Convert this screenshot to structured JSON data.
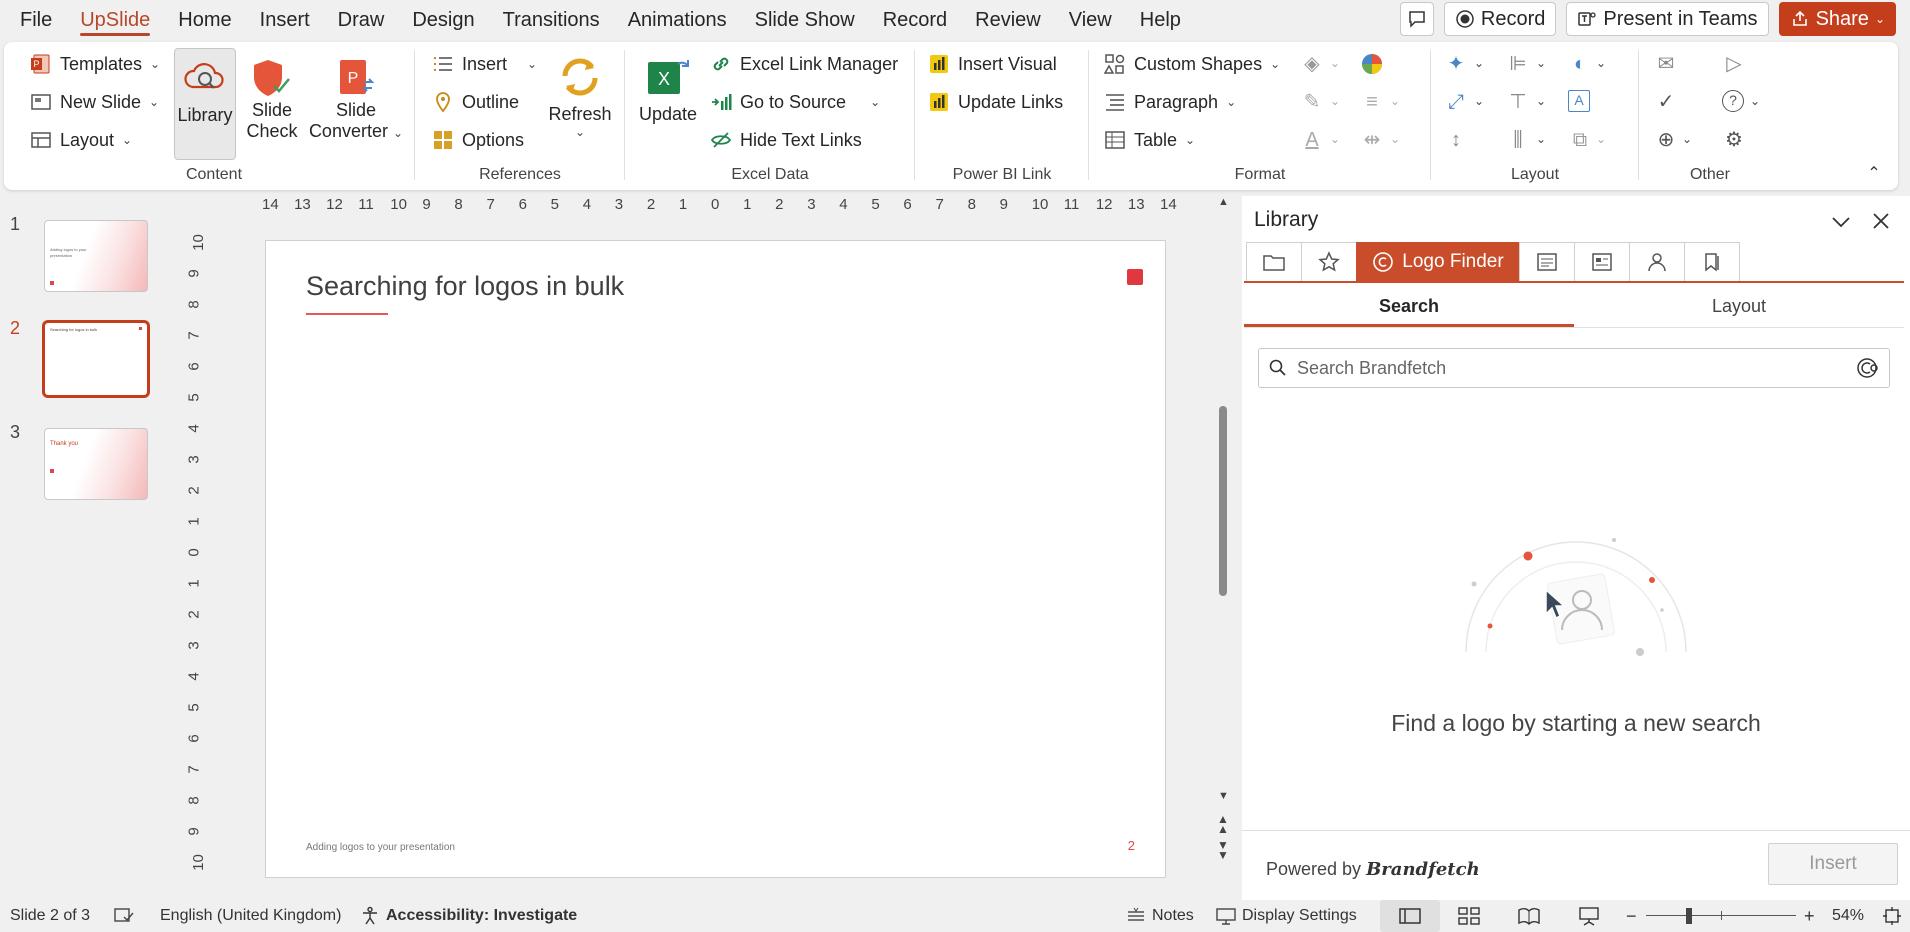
{
  "menubar": {
    "tabs": [
      "File",
      "UpSlide",
      "Home",
      "Insert",
      "Draw",
      "Design",
      "Transitions",
      "Animations",
      "Slide Show",
      "Record",
      "Review",
      "View",
      "Help"
    ],
    "active_tab": "UpSlide",
    "record_label": "Record",
    "present_label": "Present in Teams",
    "share_label": "Share"
  },
  "ribbon": {
    "content": {
      "label": "Content",
      "templates": "Templates",
      "new_slide": "New Slide",
      "layout": "Layout",
      "library": "Library",
      "slide_check_1": "Slide",
      "slide_check_2": "Check",
      "slide_converter_1": "Slide",
      "slide_converter_2": "Converter"
    },
    "references": {
      "label": "References",
      "insert": "Insert",
      "outline": "Outline",
      "options": "Options",
      "refresh": "Refresh"
    },
    "excel_data": {
      "label": "Excel Data",
      "update": "Update",
      "excel_link_manager": "Excel Link Manager",
      "go_to_source": "Go to Source",
      "hide_text_links": "Hide Text Links"
    },
    "power_bi": {
      "label": "Power BI Link",
      "insert_visual": "Insert Visual",
      "update_links": "Update Links"
    },
    "format": {
      "label": "Format",
      "custom_shapes": "Custom Shapes",
      "paragraph": "Paragraph",
      "table": "Table"
    },
    "layout": {
      "label": "Layout"
    },
    "other": {
      "label": "Other"
    }
  },
  "thumbnails": [
    {
      "num": "1",
      "caption": "Adding logos to your presentation"
    },
    {
      "num": "2",
      "caption": "Searching for logos in bulk"
    },
    {
      "num": "3",
      "caption": "Thank you"
    }
  ],
  "ruler": {
    "h_ticks": [
      "14",
      "13",
      "12",
      "11",
      "10",
      "9",
      "8",
      "7",
      "6",
      "5",
      "4",
      "3",
      "2",
      "1",
      "0",
      "1",
      "2",
      "3",
      "4",
      "5",
      "6",
      "7",
      "8",
      "9",
      "10",
      "11",
      "12",
      "13",
      "14"
    ],
    "v_ticks": [
      "10",
      "9",
      "8",
      "7",
      "6",
      "5",
      "4",
      "3",
      "2",
      "1",
      "0",
      "1",
      "2",
      "3",
      "4",
      "5",
      "6",
      "7",
      "8",
      "9",
      "10"
    ]
  },
  "slide": {
    "title": "Searching for logos in bulk",
    "footer": "Adding logos to your presentation",
    "number": "2"
  },
  "library": {
    "title": "Library",
    "active_tab": "Logo Finder",
    "subtabs": [
      "Search",
      "Layout"
    ],
    "search_placeholder": "Search Brandfetch",
    "empty_text": "Find a logo by starting a new search",
    "powered_by": "Powered by",
    "brand": "Brandfetch",
    "insert": "Insert"
  },
  "status": {
    "slide_info": "Slide 2 of 3",
    "language": "English (United Kingdom)",
    "accessibility": "Accessibility: Investigate",
    "notes": "Notes",
    "display_settings": "Display Settings",
    "zoom": "54%",
    "minus": "−",
    "plus": "+"
  },
  "colors": {
    "accent": "#b7472a",
    "pane_accent": "#c94d2a",
    "share": "#c43e1c"
  }
}
